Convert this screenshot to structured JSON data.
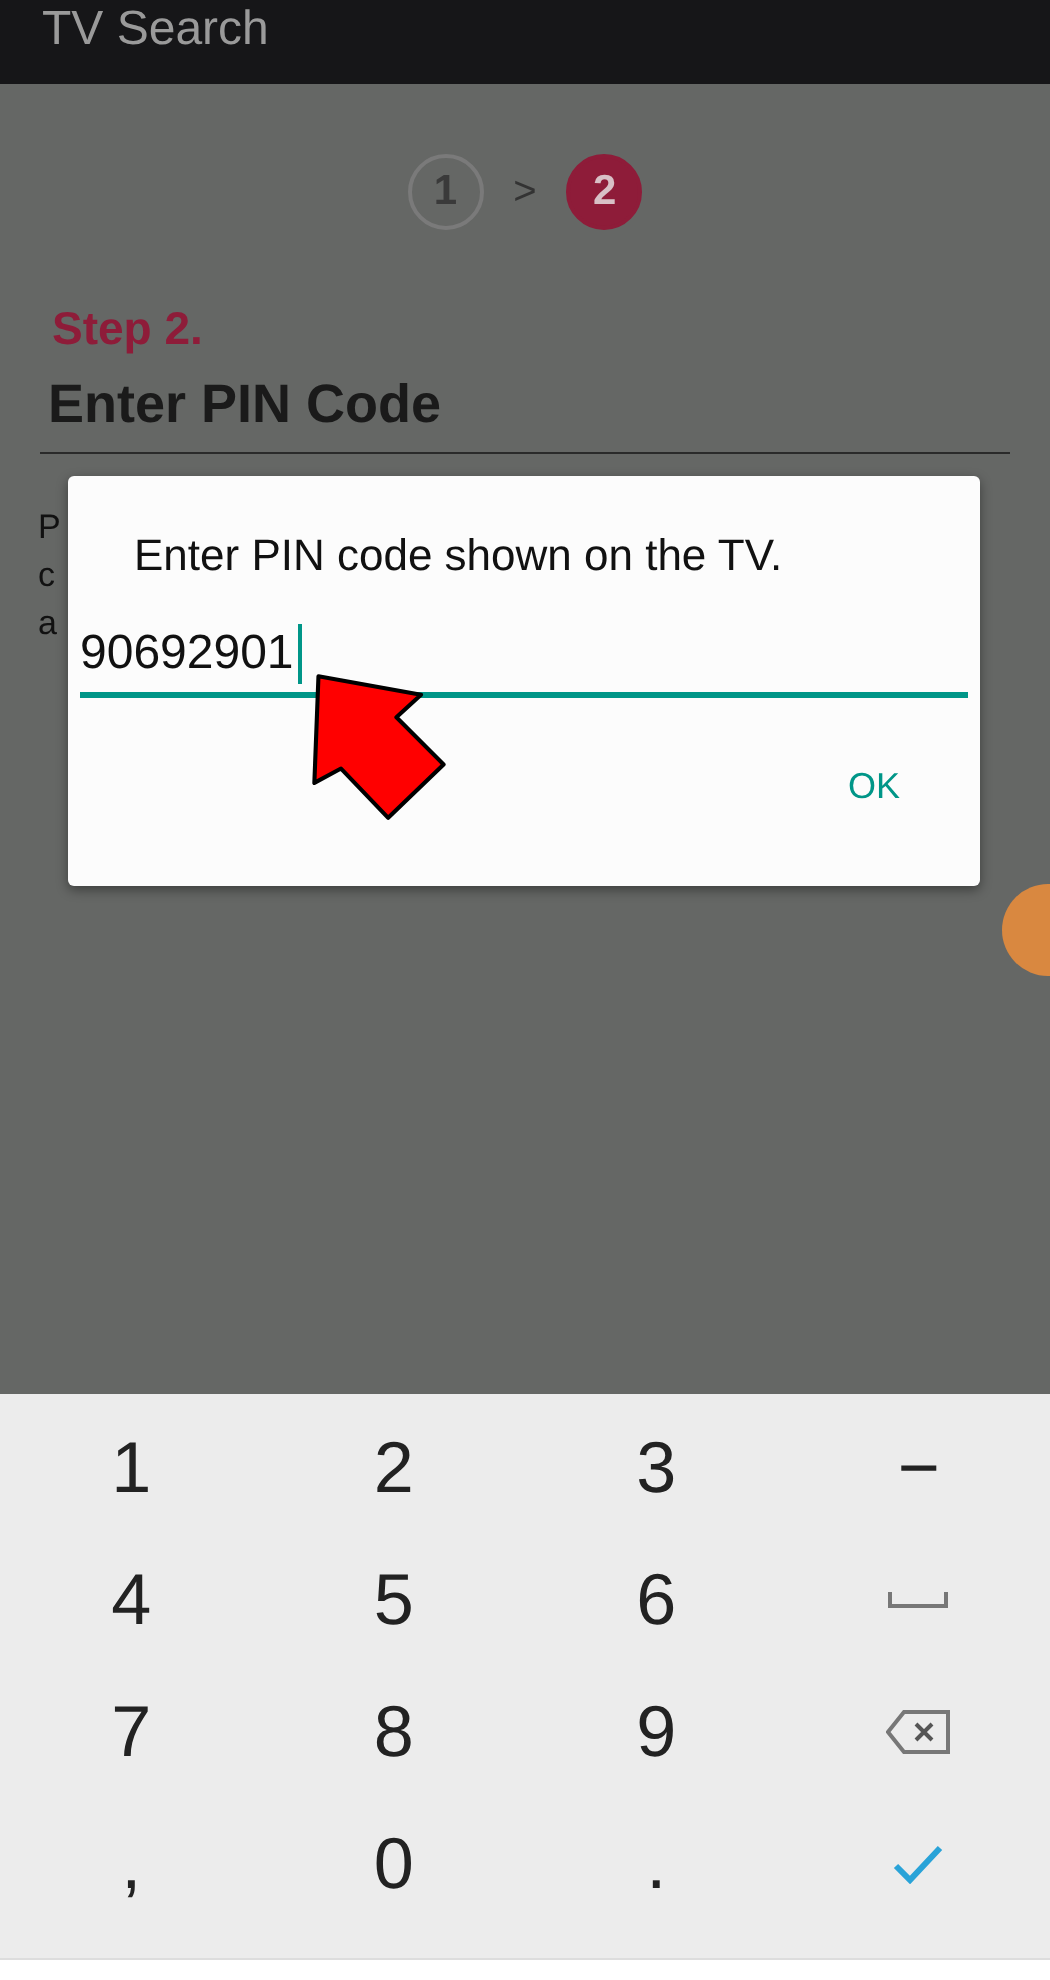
{
  "app_bar": {
    "title": "TV Search"
  },
  "stepper": {
    "steps": [
      {
        "label": "1",
        "selected": false
      },
      {
        "label": "2",
        "selected": true
      }
    ],
    "separator": ">"
  },
  "step_label": "Step 2.",
  "heading": "Enter PIN Code",
  "body_fragments": [
    "P",
    "c",
    "a"
  ],
  "dialog": {
    "message": "Enter PIN code shown on the TV.",
    "pin_value": "90692901",
    "ok_button": "OK"
  },
  "keyboard": {
    "rows": [
      [
        {
          "kind": "text",
          "label": "1"
        },
        {
          "kind": "text",
          "label": "2"
        },
        {
          "kind": "text",
          "label": "3"
        },
        {
          "kind": "text",
          "label": "−"
        }
      ],
      [
        {
          "kind": "text",
          "label": "4"
        },
        {
          "kind": "text",
          "label": "5"
        },
        {
          "kind": "text",
          "label": "6"
        },
        {
          "kind": "space"
        }
      ],
      [
        {
          "kind": "text",
          "label": "7"
        },
        {
          "kind": "text",
          "label": "8"
        },
        {
          "kind": "text",
          "label": "9"
        },
        {
          "kind": "backspace"
        }
      ],
      [
        {
          "kind": "text",
          "label": ","
        },
        {
          "kind": "text",
          "label": "0"
        },
        {
          "kind": "text",
          "label": "."
        },
        {
          "kind": "done"
        }
      ]
    ]
  }
}
